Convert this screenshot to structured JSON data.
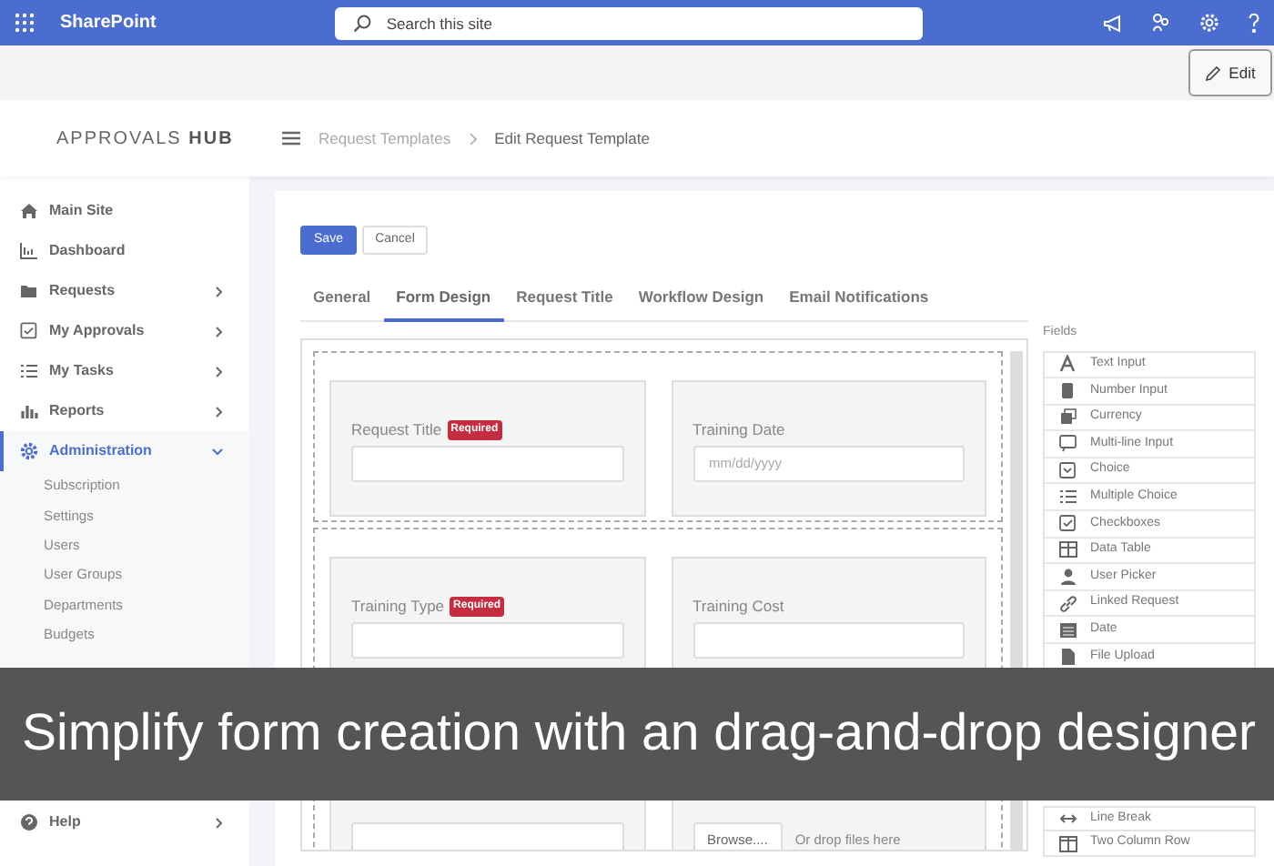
{
  "topbar": {
    "app_name": "SharePoint",
    "search_placeholder": "Search this site"
  },
  "subbar": {
    "edit_button": "Edit"
  },
  "header": {
    "brand": "APPROVALS **HUB**",
    "breadcrumb": [
      "Request Templates",
      "Edit Request Template"
    ]
  },
  "sidebar": {
    "items": [
      {
        "label": "Main Site",
        "selected": false
      },
      {
        "label": "Dashboard",
        "selected": false
      },
      {
        "label": "Requests",
        "selected": false,
        "expanded": false
      },
      {
        "label": "My Approvals",
        "selected": false,
        "expanded": false
      },
      {
        "label": "My Tasks",
        "selected": false,
        "expanded": false
      },
      {
        "label": "Reports",
        "selected": false,
        "expanded": false
      },
      {
        "label": "Administration",
        "selected": true,
        "expanded": true,
        "children": [
          {
            "label": "Subscription"
          },
          {
            "label": "Settings"
          },
          {
            "label": "Users"
          },
          {
            "label": "User Groups"
          },
          {
            "label": "Departments"
          },
          {
            "label": "Budgets"
          }
        ]
      },
      {
        "label": "Help",
        "selected": false,
        "expanded": false
      }
    ]
  },
  "actions": {
    "save": "Save",
    "cancel": "Cancel"
  },
  "tabs": [
    {
      "label": "General",
      "selected": false
    },
    {
      "label": "Form Design",
      "selected": true
    },
    {
      "label": "Request Title",
      "selected": false
    },
    {
      "label": "Workflow Design",
      "selected": false
    },
    {
      "label": "Email Notifications",
      "selected": false
    }
  ],
  "form_rows": [
    [
      {
        "kind": "text",
        "label": "Request Title",
        "badge": "Required"
      },
      {
        "kind": "date",
        "label": "Training Date",
        "placeholder": "mm/dd/yyyy"
      }
    ],
    [
      {
        "kind": "text",
        "label": "Training Type",
        "badge": "Required"
      },
      {
        "kind": "text",
        "label": "Training Cost"
      }
    ],
    [
      {
        "kind": "textarea"
      },
      {
        "kind": "file",
        "button": "Browse....",
        "hint": "Or drop files here"
      }
    ]
  ],
  "palette": {
    "fields_title": "Fields",
    "fields": [
      {
        "label": "Text Input"
      },
      {
        "label": "Number Input"
      },
      {
        "label": "Currency"
      },
      {
        "label": "Multi-line Input"
      },
      {
        "label": "Choice"
      },
      {
        "label": "Multiple Choice"
      },
      {
        "label": "Checkboxes"
      },
      {
        "label": "Data Table"
      },
      {
        "label": "User Picker"
      },
      {
        "label": "Linked Request"
      },
      {
        "label": "Date"
      },
      {
        "label": "File Upload"
      }
    ],
    "layout": [
      {
        "label": "Line Break"
      },
      {
        "label": "Two Column Row"
      }
    ]
  },
  "caption": "Simplify form creation with an drag-and-drop designer"
}
